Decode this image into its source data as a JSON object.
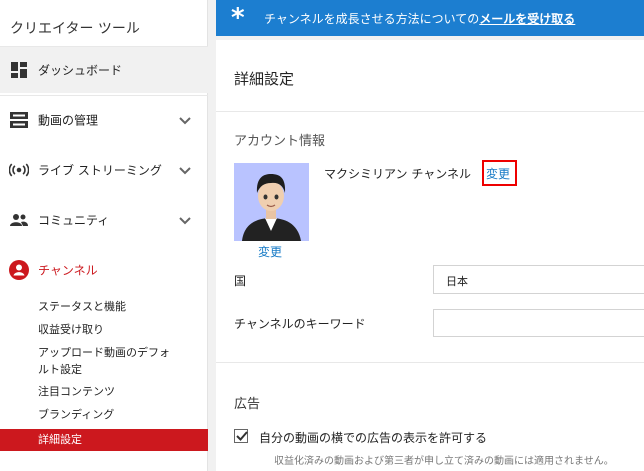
{
  "sidebar": {
    "title": "クリエイター ツール",
    "items": [
      {
        "label": "ダッシュボード",
        "icon": "dashboard-icon"
      },
      {
        "label": "動画の管理",
        "icon": "video-manager-icon"
      },
      {
        "label": "ライブ ストリーミング",
        "icon": "live-streaming-icon"
      },
      {
        "label": "コミュニティ",
        "icon": "community-icon"
      },
      {
        "label": "チャンネル",
        "icon": "channel-icon"
      }
    ],
    "channel_subitems": [
      "ステータスと機能",
      "収益受け取り",
      "アップロード動画のデフォルト設定",
      "注目コンテンツ",
      "ブランディング",
      "詳細設定"
    ],
    "upload_defaults_line1": "アップロード動画のデフォ",
    "upload_defaults_line2": "ルト設定"
  },
  "banner": {
    "text": "チャンネルを成長させる方法についての",
    "link": "メールを受け取る",
    "color": "#1c7ed0"
  },
  "main": {
    "title": "詳細設定",
    "account_section": "アカウント情報",
    "channel_name": "マクシミリアン チャンネル",
    "change_link": "変更",
    "avatar_change": "変更",
    "country_label": "国",
    "country_value": "日本",
    "keywords_label": "チャンネルのキーワード",
    "keywords_value": "",
    "ads_section": "広告",
    "ads_checkbox_label": "自分の動画の横での広告の表示を許可する",
    "ads_checkbox_checked": true,
    "ads_note": "収益化済みの動画および第三者が申し立て済みの動画には適用されません。"
  },
  "colors": {
    "accent_red": "#cc181e",
    "link_blue": "#167ac6",
    "highlight_box": "#ff0000"
  }
}
